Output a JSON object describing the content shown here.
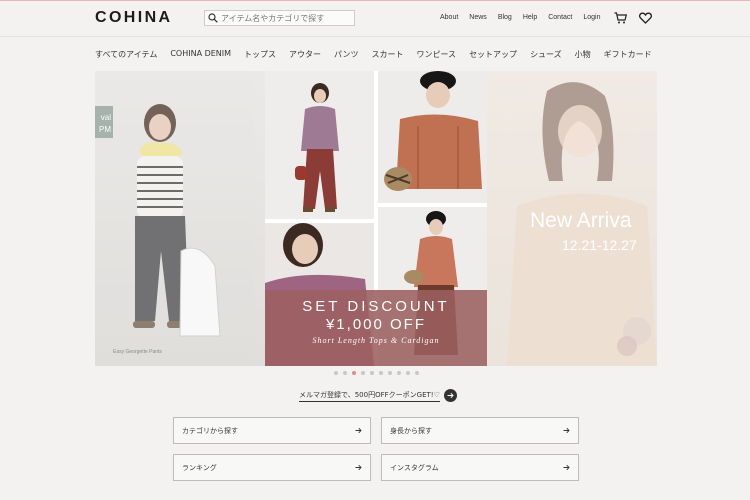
{
  "header": {
    "logo": "COHINA",
    "search_placeholder": "アイテム名やカテゴリで探す",
    "nav": [
      "About",
      "News",
      "Blog",
      "Help",
      "Contact",
      "Login"
    ]
  },
  "categories": [
    "すべてのアイテム",
    "COHINA DENIM",
    "トップス",
    "アウター",
    "パンツ",
    "スカート",
    "ワンピース",
    "セットアップ",
    "シューズ",
    "小物",
    "ギフトカード"
  ],
  "carousel": {
    "left_badge": "val\nPM",
    "left_caption": "Easy Georgette Pants",
    "main": {
      "line1": "SET DISCOUNT",
      "line2": "¥1,000 OFF",
      "line3": "Short Length Tops & Cardigan"
    },
    "right_title": "New Arriva",
    "right_date": "12.21-12.27",
    "dot_count": 10,
    "active_dot": 2
  },
  "mailmag": {
    "text": "メルマガ登録で、500円OFFクーポンGET!♡"
  },
  "links": {
    "category": "カテゴリから探す",
    "height": "身長から探す",
    "ranking": "ランキング",
    "instagram": "インスタグラム"
  },
  "colors": {
    "accent": "#9c6060",
    "dot_active": "#e78b83",
    "background": "#f3f2f1"
  },
  "icons": {
    "search": "search-icon",
    "cart": "cart-icon",
    "favorite": "heart-icon",
    "arrow": "arrow-right-icon"
  }
}
